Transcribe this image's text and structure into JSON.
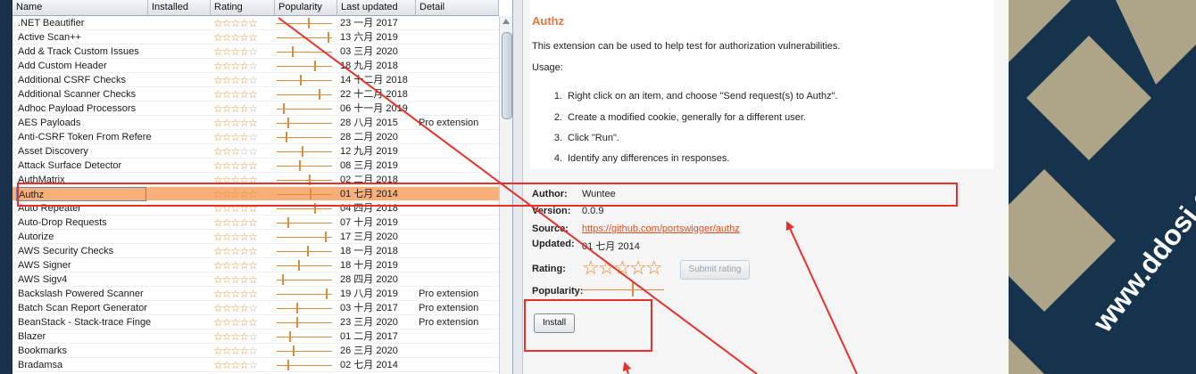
{
  "table": {
    "headers": [
      "Name",
      "Installed",
      "Rating",
      "Popularity",
      "Last updated",
      "Detail"
    ],
    "rows": [
      {
        "name": ".NET Beautifier",
        "rating": 5,
        "pop": 58,
        "date": "23 一月 2017",
        "detail": ""
      },
      {
        "name": "Active Scan++",
        "rating": 5,
        "pop": 95,
        "date": "13 六月 2019",
        "detail": ""
      },
      {
        "name": "Add & Track Custom Issues",
        "rating": 4,
        "pop": 28,
        "date": "03 三月 2020",
        "detail": ""
      },
      {
        "name": "Add Custom Header",
        "rating": 4,
        "pop": 70,
        "date": "18 九月 2018",
        "detail": ""
      },
      {
        "name": "Additional CSRF Checks",
        "rating": 4,
        "pop": 44,
        "date": "14 十二月 2018",
        "detail": ""
      },
      {
        "name": "Additional Scanner Checks",
        "rating": 5,
        "pop": 78,
        "date": "22 十二月 2018",
        "detail": ""
      },
      {
        "name": "Adhoc Payload Processors",
        "rating": 4,
        "pop": 12,
        "date": "06 十一月 2019",
        "detail": ""
      },
      {
        "name": "AES Payloads",
        "rating": 5,
        "pop": 20,
        "date": "28 八月 2015",
        "detail": "Pro extension"
      },
      {
        "name": "Anti-CSRF Token From Referer",
        "rating": 4,
        "pop": 16,
        "date": "28 二月 2020",
        "detail": ""
      },
      {
        "name": "Asset Discovery",
        "rating": 3,
        "pop": 46,
        "date": "12 九月 2019",
        "detail": ""
      },
      {
        "name": "Attack Surface Detector",
        "rating": 5,
        "pop": 42,
        "date": "08 三月 2019",
        "detail": ""
      },
      {
        "name": "AuthMatrix",
        "rating": 5,
        "pop": 60,
        "date": "02 二月 2018",
        "detail": ""
      },
      {
        "name": "Authz",
        "rating": 5,
        "pop": 62,
        "date": "01 七月 2014",
        "detail": ""
      },
      {
        "name": "Auto Repeater",
        "rating": 5,
        "pop": 70,
        "date": "04 四月 2018",
        "detail": ""
      },
      {
        "name": "Auto-Drop Requests",
        "rating": 5,
        "pop": 20,
        "date": "07 十月 2019",
        "detail": ""
      },
      {
        "name": "Autorize",
        "rating": 5,
        "pop": 90,
        "date": "17 三月 2020",
        "detail": ""
      },
      {
        "name": "AWS Security Checks",
        "rating": 5,
        "pop": 56,
        "date": "18 一月 2018",
        "detail": ""
      },
      {
        "name": "AWS Signer",
        "rating": 5,
        "pop": 40,
        "date": "18 十月 2019",
        "detail": ""
      },
      {
        "name": "AWS Sigv4",
        "rating": 5,
        "pop": 10,
        "date": "28 四月 2020",
        "detail": ""
      },
      {
        "name": "Backslash Powered Scanner",
        "rating": 5,
        "pop": 92,
        "date": "19 八月 2019",
        "detail": "Pro extension"
      },
      {
        "name": "Batch Scan Report Generator",
        "rating": 4,
        "pop": 36,
        "date": "03 十月 2017",
        "detail": "Pro extension"
      },
      {
        "name": "BeanStack - Stack-trace Finge...",
        "rating": 5,
        "pop": 36,
        "date": "23 三月 2020",
        "detail": "Pro extension"
      },
      {
        "name": "Blazer",
        "rating": 4,
        "pop": 24,
        "date": "01 二月 2017",
        "detail": ""
      },
      {
        "name": "Bookmarks",
        "rating": 4,
        "pop": 30,
        "date": "26 三月 2020",
        "detail": ""
      },
      {
        "name": "Bradamsa",
        "rating": 4,
        "pop": 20,
        "date": "02 七月 2014",
        "detail": ""
      }
    ],
    "selected_index": 12
  },
  "detail": {
    "title": "Authz",
    "description": "This extension can be used to help test for authorization vulnerabilities.",
    "usage_label": "Usage:",
    "steps": [
      {
        "num": "1.",
        "text": "Right click on an item, and choose \"Send request(s) to Authz\"."
      },
      {
        "num": "2.",
        "text": "Create a modified cookie, generally for a different user."
      },
      {
        "num": "3.",
        "text": "Click \"Run\"."
      },
      {
        "num": "4.",
        "text": "Identify any differences in responses."
      }
    ],
    "author_label": "Author:",
    "author": "Wuntee",
    "version_label": "Version:",
    "version": "0.0.9",
    "source_label": "Source:",
    "source": "https://github.com/portswigger/authz",
    "updated_label": "Updated:",
    "updated": "01 七月 2014",
    "rating_label": "Rating:",
    "rating": 5,
    "submit_rating_label": "Submit rating",
    "popularity_label": "Popularity:",
    "popularity": 62,
    "install_label": "Install"
  },
  "watermark": {
    "text": "www.ddosi.com"
  },
  "colors": {
    "accent": "#e8743b",
    "selection": "#f7b07a",
    "annotation": "#e8302a",
    "star": "#e58a2c"
  }
}
